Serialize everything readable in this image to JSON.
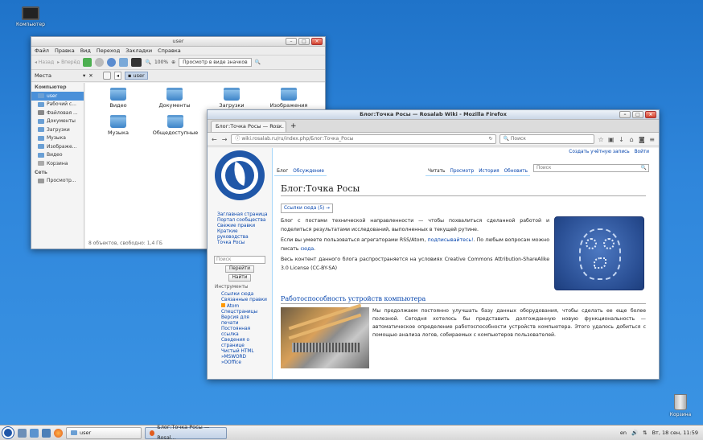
{
  "desktop": {
    "computer_label": "Компьютер",
    "trash_label": "Корзина"
  },
  "file_manager": {
    "title": "user",
    "menu": [
      "Файл",
      "Правка",
      "Вид",
      "Переход",
      "Закладки",
      "Справка"
    ],
    "toolbar": {
      "back": "Назад",
      "forward": "Вперёд",
      "zoom": "100%",
      "view_mode": "Просмотр в виде значков"
    },
    "places_label": "Места",
    "path": "user",
    "sidebar": {
      "computer_head": "Компьютер",
      "items": [
        "user",
        "Рабочий с...",
        "Файловая ...",
        "Документы",
        "Загрузки",
        "Музыка",
        "Изображе...",
        "Видео",
        "Корзина"
      ],
      "network_head": "Сеть",
      "network_items": [
        "Просмотр..."
      ]
    },
    "folders": [
      "Видео",
      "Документы",
      "Загрузки",
      "Изображения",
      "Музыка",
      "Общедоступные"
    ],
    "status": "8 объектов, свободно: 1,4 ГБ"
  },
  "firefox": {
    "title": "Блог:Точка Росы — Rosalab Wiki - Mozilla Firefox",
    "tab_label": "Блог:Точка Росы — Ros...",
    "url": "wiki.rosalab.ru/ru/index.php/Блог:Точка_Росы",
    "search_placeholder": "Поиск",
    "wiki": {
      "top_links": [
        "Создать учётную запись",
        "Войти"
      ],
      "nav_links": [
        "Заглавная страница",
        "Портал сообщества",
        "Свежие правки",
        "Краткие руководства",
        "Точка Росы"
      ],
      "side_search_placeholder": "Поиск",
      "go_button": "Перейти",
      "find_button": "Найти",
      "tools_head": "Инструменты",
      "tools": [
        "Ссылки сюда",
        "Связанные правки",
        "Atom",
        "Спецстраницы",
        "Версия для печати",
        "Постоянная ссылка",
        "Сведения о странице",
        "Чистый HTML",
        "»MSWORD",
        "»OOffice"
      ],
      "tabs_left": [
        "Блог",
        "Обсуждение"
      ],
      "tabs_right": [
        "Читать",
        "Просмотр",
        "История",
        "Обновить"
      ],
      "search_placeholder": "Поиск",
      "heading": "Блог:Точка Росы",
      "links_box": "Ссылки сюда (5) →",
      "para1": "Блог с постами технической направленности — чтобы похвалиться сделанной работой и поделиться результатами исследований, выполненных в текущей рутине.",
      "para2_a": "Если вы умеете пользоваться агрегаторами RSS/Atom, ",
      "para2_link": "подписывайтесь!",
      "para2_b": ". По любым вопросам можно писать ",
      "para2_link2": "сюда",
      "para2_c": ".",
      "para3": "Весь контент данного блога распространяется на условиях Creative Commons Attribution-ShareAlike 3.0 License (CC-BY-SA)",
      "post_title": "Работоспособность устройств компьютера",
      "post_text": "Мы продолжаем постоянно улучшать базу данных оборудования, чтобы сделать ее еще более полезной. Сегодня хотелось бы представить долгожданную новую функциональность — автоматическое определение работоспособности устройств компьютера. Этого удалось добиться с помощью анализа логов, собираемых с компьютеров пользователей."
    }
  },
  "taskbar": {
    "tasks": [
      "user",
      "Блог:Точка Росы — Rosal..."
    ],
    "lang": "en",
    "clock": "Вт, 18 сен, 11:59"
  },
  "colors": {
    "desktop": "#2f86db",
    "link": "#0645ad",
    "selection": "#4a90d9",
    "rosa_blue": "#2057a8"
  }
}
